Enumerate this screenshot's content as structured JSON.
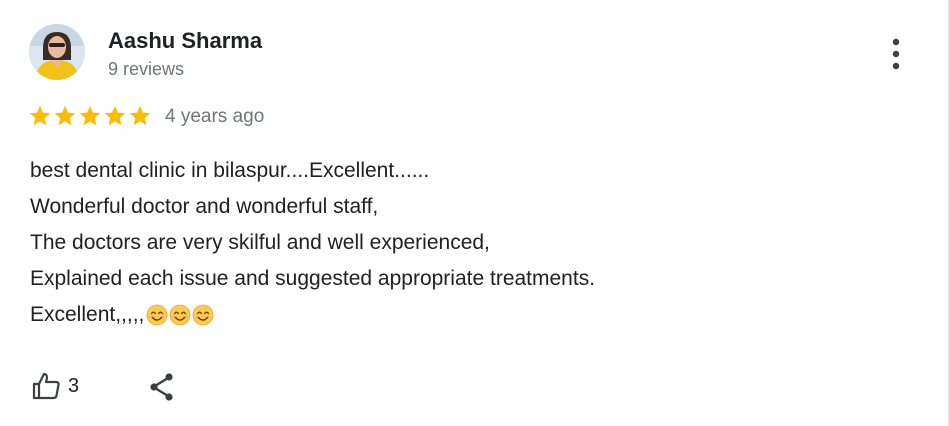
{
  "review": {
    "author_name": "Aashu Sharma",
    "author_reviews": "9 reviews",
    "rating": 5,
    "rating_max": 5,
    "time_ago": "4 years ago",
    "text_lines": [
      "best dental clinic in bilaspur....Excellent......",
      "Wonderful doctor and wonderful staff,",
      "The doctors are very skilful and well experienced,",
      "Explained each issue and suggested appropriate treatments.",
      "Excellent,,,,,"
    ],
    "trailing_emojis": [
      "smiling-face-with-smiling-eyes",
      "smiling-face-with-smiling-eyes",
      "smiling-face-with-smiling-eyes"
    ],
    "like_count": "3"
  },
  "icons": {
    "more": "more-vert-icon",
    "star": "star-icon",
    "like": "thumbs-up-icon",
    "share": "share-icon"
  },
  "colors": {
    "star": "#fbbc04",
    "primary_text": "#202124",
    "secondary_text": "#70757a",
    "icon": "#3c4043"
  }
}
